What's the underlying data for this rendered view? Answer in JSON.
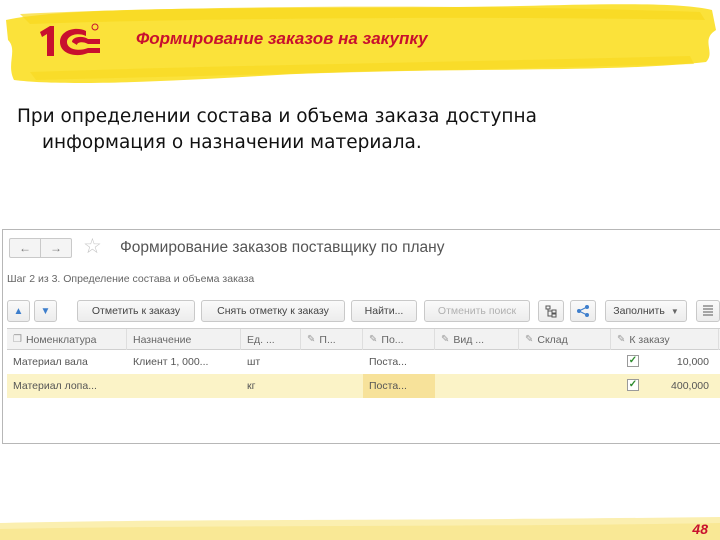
{
  "slide": {
    "title": "Формирование заказов на закупку",
    "body_line1": "При определении состава и объема заказа доступна",
    "body_line2": "информация о назначении материала.",
    "page_number": "48",
    "logo_text": "1С",
    "accent_color": "#c8102e",
    "banner_color": "#fbe23a"
  },
  "window": {
    "title": "Формирование заказов поставщику по плану",
    "step": "Шаг 2 из 3. Определение состава и объема заказа",
    "back_icon": "arrow-left-icon",
    "forward_icon": "arrow-right-icon",
    "favorite_icon": "star-icon"
  },
  "toolbar": {
    "mark": "Отметить к заказу",
    "unmark": "Снять отметку к заказу",
    "find": "Найти...",
    "cancel_search": "Отменить поиск",
    "fill": "Заполнить"
  },
  "table": {
    "columns": [
      "Номенклатура",
      "Назначение",
      "Ед. ...",
      "П...",
      "По...",
      "Вид ...",
      "Склад",
      "К заказу"
    ],
    "rows": [
      {
        "item": "Материал вала",
        "purpose": "Клиент 1, 000...",
        "unit": "шт",
        "p": "",
        "po": "Поста...",
        "kind": "",
        "warehouse": "",
        "checked": true,
        "qty": "10,000"
      },
      {
        "item": "Материал лопа...",
        "purpose": "",
        "unit": "кг",
        "p": "",
        "po": "Поста...",
        "kind": "",
        "warehouse": "",
        "checked": true,
        "qty": "400,000"
      }
    ]
  }
}
